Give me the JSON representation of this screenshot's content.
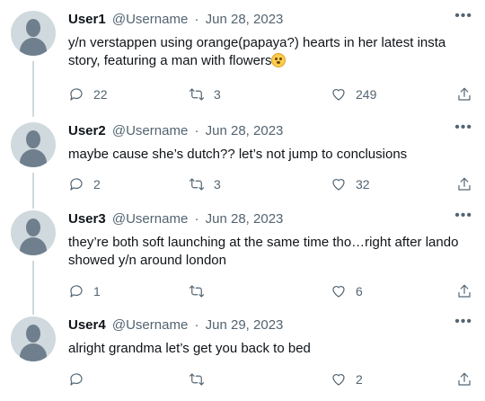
{
  "tweets": [
    {
      "name": "User1",
      "handle": "@Username",
      "sep": "·",
      "date": "Jun 28, 2023",
      "text": "y/n verstappen using orange(papaya?) hearts in her latest insta story, featuring a man with flowers",
      "emoji": "flushed-face-emoji",
      "replies": "22",
      "retweets": "3",
      "likes": "249"
    },
    {
      "name": "User2",
      "handle": "@Username",
      "sep": "·",
      "date": "Jun 28, 2023",
      "text": "maybe cause she’s dutch?? let’s not jump to conclusions",
      "replies": "2",
      "retweets": "3",
      "likes": "32"
    },
    {
      "name": "User3",
      "handle": "@Username",
      "sep": "·",
      "date": "Jun 28, 2023",
      "text": "they’re both soft launching at the same time tho…right after lando showed y/n around london",
      "replies": "1",
      "retweets": "",
      "likes": "6"
    },
    {
      "name": "User4",
      "handle": "@Username",
      "sep": "·",
      "date": "Jun 29, 2023",
      "text": "alright grandma let’s get you back to bed",
      "replies": "",
      "retweets": "",
      "likes": "2"
    }
  ],
  "more_label": "•••",
  "colors": {
    "text": "#0f1419",
    "secondary": "#536471",
    "avatar_bg": "#cfd9de",
    "avatar_fg": "#6f7f8d"
  }
}
